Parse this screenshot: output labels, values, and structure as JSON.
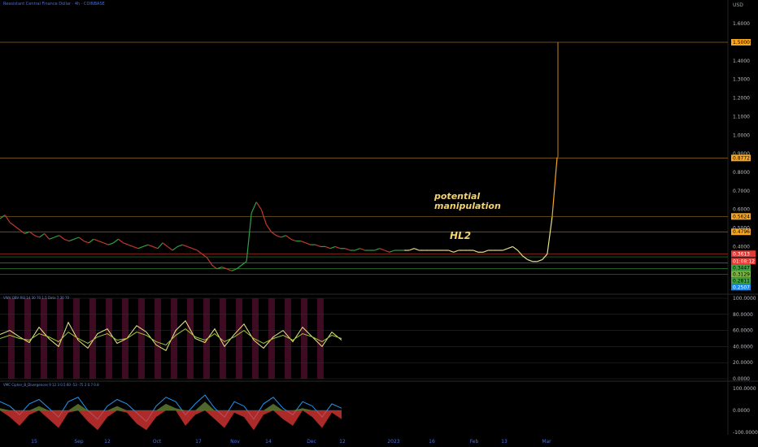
{
  "header": {
    "title": "Reesistant Central Finance Dollar · 4h · COINBASE",
    "currency": "USD"
  },
  "annotations": {
    "note1": "potential\nmanipulation",
    "note2": "HL2"
  },
  "indicators": {
    "ind1_label": "VWV OBV RSI 14 30 70 1.5 Data 7 30 70",
    "ind2_label": "VMC Cipher_B_Divergences 9 12 3 0.5 60 -53 -75 2 0.7 0.8"
  },
  "colors": {
    "price_up": "#2ea043",
    "price_down": "#c0392b",
    "level": "#b5862a",
    "accent": "#f5a623"
  },
  "chart_data": [
    {
      "type": "line",
      "title": "",
      "xlabel": "",
      "ylabel": "USD",
      "x_ticks": [
        "15",
        "Sep",
        "12",
        "Oct",
        "17",
        "Nov",
        "14",
        "Dec",
        "12",
        "2023",
        "16",
        "Feb",
        "13",
        "Mar"
      ],
      "y_ticks": [
        "1.6000",
        "1.5000",
        "1.4000",
        "1.3000",
        "1.2000",
        "1.1000",
        "1.0000",
        "0.9000",
        "0.8000",
        "0.7000",
        "0.6000",
        "0.5000",
        "0.4000",
        "0.3000"
      ],
      "ylim": [
        0.24,
        1.64
      ],
      "log_scale": false,
      "price_labels": [
        {
          "value": "1.5000",
          "color": "#f5a623",
          "text": "#000000"
        },
        {
          "value": "0.8772",
          "color": "#f5a623",
          "text": "#000000"
        },
        {
          "value": "0.5624",
          "color": "#f5a623",
          "text": "#000000"
        },
        {
          "value": "0.4796",
          "color": "#f5a623",
          "text": "#000000"
        },
        {
          "value": "0.3613",
          "color": "#e53935",
          "text": "#ffffff"
        },
        {
          "value": "01:08:12",
          "color": "#e53935",
          "text": "#ffffff"
        },
        {
          "value": "0.3447",
          "color": "#43a047",
          "text": "#000000"
        },
        {
          "value": "0.3129",
          "color": "#7cb342",
          "text": "#000000"
        },
        {
          "value": "0.2811",
          "color": "#43a047",
          "text": "#000000"
        },
        {
          "value": "0.2507",
          "color": "#1e88e5",
          "text": "#ffffff"
        }
      ],
      "levels": [
        1.5,
        0.8772,
        0.5624,
        0.4796,
        0.3613,
        0.3447,
        0.3129,
        0.2811,
        0.2507
      ],
      "series": [
        {
          "values": [
            0.55,
            0.57,
            0.53,
            0.51,
            0.49,
            0.47,
            0.48,
            0.46,
            0.45,
            0.47,
            0.44,
            0.45,
            0.46,
            0.44,
            0.43,
            0.44,
            0.45,
            0.43,
            0.42,
            0.44,
            0.43,
            0.42,
            0.41,
            0.42,
            0.44,
            0.42,
            0.41,
            0.4,
            0.39,
            0.4,
            0.41,
            0.4,
            0.39,
            0.42,
            0.4,
            0.38,
            0.4,
            0.41,
            0.4,
            0.39,
            0.38,
            0.36,
            0.34,
            0.3,
            0.28,
            0.29,
            0.28,
            0.27,
            0.28,
            0.3,
            0.32,
            0.58,
            0.64,
            0.6,
            0.52,
            0.48,
            0.46,
            0.45,
            0.46,
            0.44,
            0.43,
            0.43,
            0.42,
            0.41,
            0.41,
            0.4,
            0.4,
            0.39,
            0.4,
            0.39,
            0.39,
            0.38,
            0.38,
            0.39,
            0.38,
            0.38,
            0.38,
            0.39,
            0.38,
            0.37,
            0.38,
            0.38,
            0.38,
            0.38,
            0.39,
            0.38,
            0.38,
            0.38,
            0.38,
            0.38,
            0.38,
            0.38,
            0.37,
            0.38,
            0.38,
            0.38,
            0.38,
            0.37,
            0.37,
            0.38,
            0.38,
            0.38,
            0.38,
            0.39,
            0.4,
            0.38,
            0.35,
            0.33,
            0.32,
            0.32,
            0.33,
            0.36,
            0.56,
            0.88
          ],
          "color_from": "#8b3a2a"
        }
      ]
    },
    {
      "type": "line",
      "title": "",
      "y_ticks": [
        "100.0000",
        "80.0000",
        "60.0000",
        "40.0000",
        "20.0000",
        "0.0000"
      ],
      "ylim": [
        0,
        100
      ],
      "series": [
        {
          "color": "#f0e68c",
          "values": [
            55,
            60,
            52,
            45,
            64,
            50,
            40,
            70,
            48,
            38,
            56,
            62,
            44,
            50,
            66,
            58,
            42,
            35,
            60,
            72,
            50,
            45,
            62,
            40,
            55,
            68,
            48,
            38,
            52,
            60,
            46,
            64,
            52,
            40,
            58,
            48
          ]
        },
        {
          "color": "#9acd32",
          "values": [
            50,
            54,
            50,
            48,
            56,
            52,
            46,
            58,
            50,
            44,
            52,
            56,
            48,
            50,
            58,
            54,
            46,
            42,
            54,
            62,
            52,
            48,
            56,
            46,
            52,
            60,
            50,
            44,
            50,
            54,
            48,
            56,
            52,
            46,
            54,
            50
          ]
        }
      ]
    },
    {
      "type": "area",
      "title": "",
      "y_ticks": [
        "100.0000",
        "0.0000",
        "-100.0000"
      ],
      "ylim": [
        -100,
        100
      ],
      "series": [
        {
          "color": "#2196f3",
          "values": [
            40,
            20,
            -20,
            30,
            50,
            10,
            -30,
            40,
            60,
            0,
            -40,
            20,
            50,
            30,
            -10,
            -50,
            20,
            60,
            40,
            -20,
            30,
            70,
            10,
            -30,
            40,
            20,
            -40,
            30,
            60,
            10,
            -20,
            40,
            20,
            -30,
            30,
            10
          ]
        },
        {
          "color": "#e53935",
          "values": [
            10,
            -30,
            -70,
            -20,
            20,
            -40,
            -80,
            -10,
            30,
            -50,
            -90,
            -30,
            20,
            -10,
            -60,
            -90,
            -30,
            30,
            10,
            -70,
            -20,
            40,
            -40,
            -80,
            -10,
            -30,
            -90,
            -20,
            30,
            -40,
            -70,
            10,
            -30,
            -80,
            -10,
            -40
          ]
        }
      ]
    }
  ]
}
